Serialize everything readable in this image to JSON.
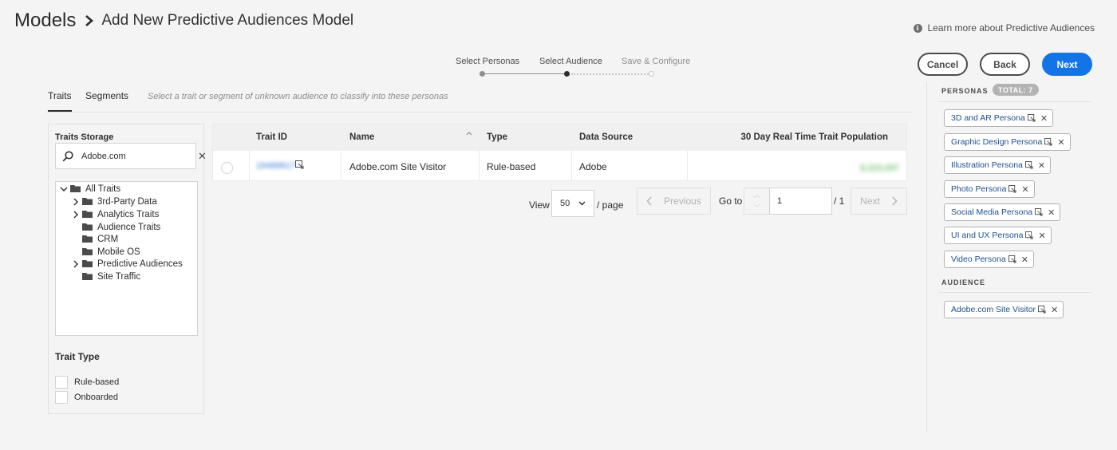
{
  "header": {
    "title": "Models",
    "subtitle": "Add New Predictive Audiences Model",
    "learn_more": "Learn more about Predictive Audiences"
  },
  "stepper": {
    "steps": [
      "Select Personas",
      "Select Audience",
      "Save & Configure"
    ],
    "current": 1
  },
  "actions": {
    "cancel": "Cancel",
    "back": "Back",
    "next": "Next"
  },
  "tabs": {
    "items": [
      "Traits",
      "Segments"
    ],
    "active": "Traits",
    "hint": "Select a trait or segment of unknown audience to classify into these personas"
  },
  "left": {
    "storage_title": "Traits Storage",
    "search_value": "Adobe.com",
    "tree": [
      {
        "label": "All Traits",
        "expanded": true
      },
      {
        "label": "3rd-Party Data",
        "expandable": true
      },
      {
        "label": "Analytics Traits",
        "expandable": true
      },
      {
        "label": "Audience Traits",
        "expandable": false
      },
      {
        "label": "CRM",
        "expandable": false
      },
      {
        "label": "Mobile OS",
        "expandable": false
      },
      {
        "label": "Predictive Audiences",
        "expandable": true
      },
      {
        "label": "Site Traffic",
        "expandable": false
      }
    ],
    "trait_type_title": "Trait Type",
    "trait_types": [
      "Rule-based",
      "Onboarded"
    ]
  },
  "table": {
    "columns": [
      "Trait ID",
      "Name",
      "Type",
      "Data Source",
      "30 Day Real Time Trait Population"
    ],
    "rows": [
      {
        "trait_id": "19488817",
        "name": "Adobe.com Site Visitor",
        "type": "Rule-based",
        "source": "Adobe",
        "population": "8,315,097"
      }
    ]
  },
  "pagination": {
    "view_label": "View",
    "page_size": "50",
    "per_page": "/ page",
    "previous": "Previous",
    "goto_label": "Go to",
    "page_value": "1",
    "total_pages": "/ 1",
    "next": "Next"
  },
  "right": {
    "personas_label": "PERSONAS",
    "total_badge": "TOTAL: 7",
    "personas": [
      "3D and AR Persona",
      "Graphic Design Persona",
      "Illustration Persona",
      "Photo Persona",
      "Social Media Persona",
      "UI and UX Persona",
      "Video Persona"
    ],
    "audience_label": "AUDIENCE",
    "audience": [
      "Adobe.com Site Visitor"
    ]
  },
  "colors": {
    "accent": "#1473e6",
    "tag_text": "#1f4f8f",
    "background": "#f4f4f4"
  }
}
